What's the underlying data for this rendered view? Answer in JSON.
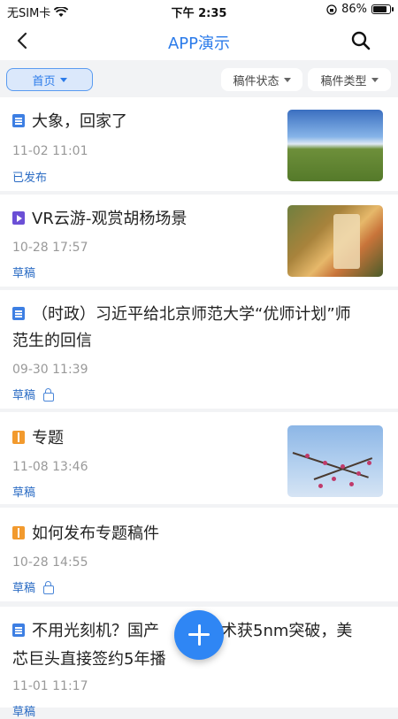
{
  "status_bar": {
    "carrier": "无SIM卡",
    "time": "下午 2:35",
    "battery": "86%",
    "battery_level": 0.86
  },
  "header": {
    "title": "APP演示",
    "back_icon": "chevron-left-icon",
    "search_icon": "search-icon"
  },
  "filters": {
    "home_label": "首页",
    "status_label": "稿件状态",
    "type_label": "稿件类型"
  },
  "articles": [
    {
      "type": "document",
      "title": "大象，回家了",
      "time": "11-02 11:01",
      "status": "已发布",
      "locked": false,
      "thumbnail": "grassland-sky"
    },
    {
      "type": "video",
      "title": "VR云游-观赏胡杨场景",
      "time": "10-28 17:57",
      "status": "草稿",
      "locked": false,
      "thumbnail": "poplar-scene"
    },
    {
      "type": "document",
      "title_line1": "（时政）习近平给北京师范大学“优师计划”师",
      "title_line2": "范生的回信",
      "time": "09-30 11:39",
      "status": "草稿",
      "locked": true
    },
    {
      "type": "topic",
      "title": "专题",
      "time": "11-08 13:46",
      "status": "草稿",
      "locked": false,
      "thumbnail": "plum-blossom"
    },
    {
      "type": "topic",
      "title": "如何发布专题稿件",
      "time": "10-28 14:55",
      "status": "草稿",
      "locked": true
    },
    {
      "type": "document",
      "title_line1": "不用光刻机？国产",
      "title_line1b": "技术获5nm突破，美",
      "title_line2": "芯巨头直接签约5年播",
      "time": "11-01 11:17",
      "status": "草稿",
      "locked": false
    }
  ],
  "fab": {
    "icon": "plus-icon"
  },
  "colors": {
    "accent": "#2b7bea",
    "status": "#2b6cc4",
    "fab": "#2f86f4"
  }
}
